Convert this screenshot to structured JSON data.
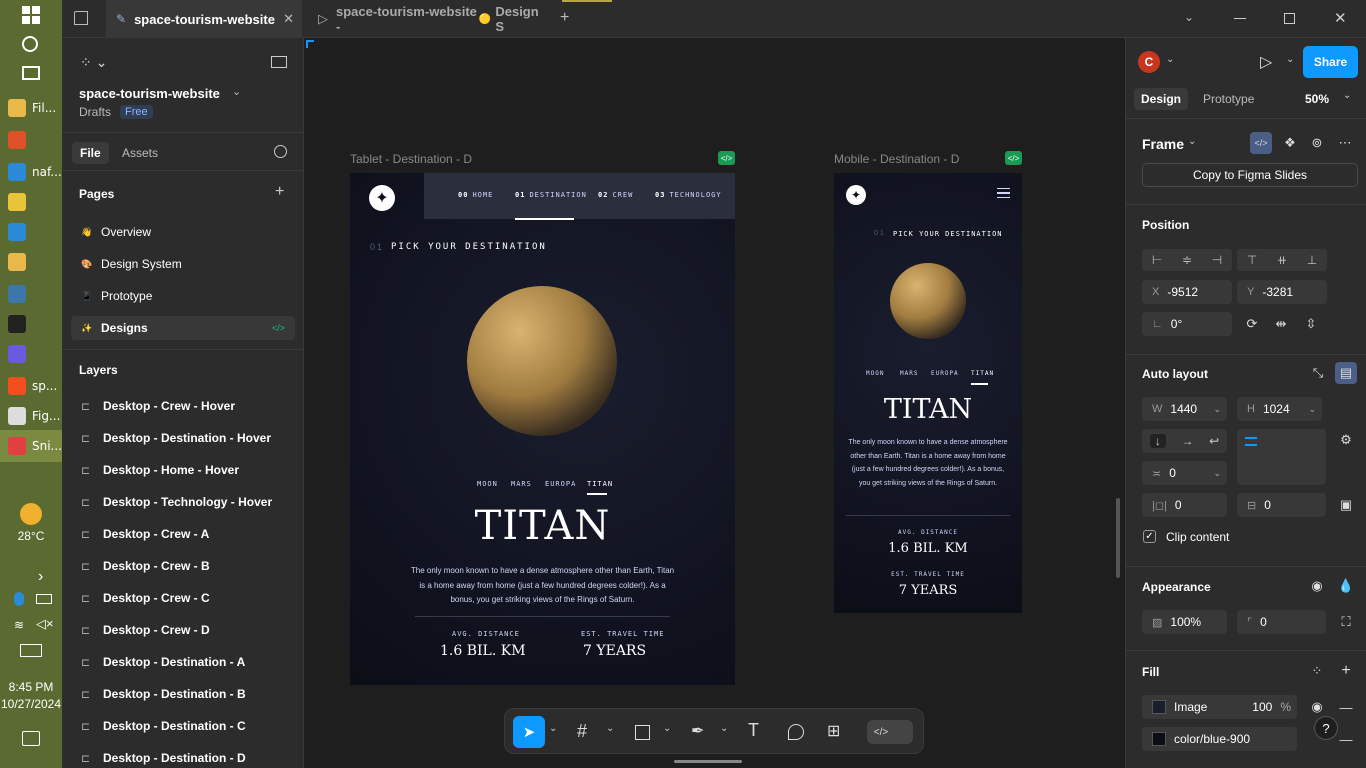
{
  "taskbar": {
    "items": [
      {
        "label": "Fil...",
        "icon": "folder-icon",
        "color": "#e8b84b"
      },
      {
        "label": "",
        "icon": "brave-icon",
        "color": "#e0502a"
      },
      {
        "label": "naf...",
        "icon": "edge-icon",
        "color": "#2b8ad8"
      },
      {
        "label": "",
        "icon": "chrome-icon",
        "color": "#e8c43a"
      },
      {
        "label": "",
        "icon": "vscode-icon",
        "color": "#2b8ad8"
      },
      {
        "label": "",
        "icon": "store-icon",
        "color": "#e8b84b"
      },
      {
        "label": "",
        "icon": "python-icon",
        "color": "#3b77a8"
      },
      {
        "label": "",
        "icon": "arc-icon",
        "color": "#222222"
      },
      {
        "label": "",
        "icon": "copilot-icon",
        "color": "#6a5ae0"
      },
      {
        "label": "sp...",
        "icon": "figma-icon",
        "color": "#f24e1e"
      },
      {
        "label": "Fig...",
        "icon": "figma-file-icon",
        "color": "#dddddd"
      },
      {
        "label": "Sni...",
        "icon": "snipping-icon",
        "color": "#e04040"
      }
    ],
    "weather": "28°C",
    "time": "8:45 PM",
    "date": "10/27/2024"
  },
  "tabs": [
    {
      "label": "space-tourism-website"
    },
    {
      "label": "space-tourism-website - ",
      "suffix": "Design S"
    }
  ],
  "left": {
    "project": "space-tourism-website",
    "drafts": "Drafts",
    "plan": "Free",
    "tab_file": "File",
    "tab_assets": "Assets",
    "pages_title": "Pages",
    "pages": [
      {
        "label": "Overview",
        "emoji": "👋"
      },
      {
        "label": "Design System",
        "emoji": "🎨"
      },
      {
        "label": "Prototype",
        "emoji": "📱"
      },
      {
        "label": "Designs",
        "emoji": "✨"
      }
    ],
    "layers_title": "Layers",
    "layers": [
      "Desktop - Crew - Hover",
      "Desktop - Destination - Hover",
      "Desktop - Home - Hover",
      "Desktop - Technology - Hover",
      "Desktop - Crew - A",
      "Desktop - Crew - B",
      "Desktop - Crew - C",
      "Desktop - Crew - D",
      "Desktop - Destination - A",
      "Desktop - Destination - B",
      "Desktop - Destination - C",
      "Desktop - Destination - D"
    ]
  },
  "canvas": {
    "tablet_label": "Tablet - Destination - D",
    "mobile_label": "Mobile - Destination - D",
    "nav": [
      {
        "num": "00",
        "label": "HOME"
      },
      {
        "num": "01",
        "label": "DESTINATION"
      },
      {
        "num": "02",
        "label": "CREW"
      },
      {
        "num": "03",
        "label": "TECHNOLOGY"
      }
    ],
    "heading_num": "01",
    "heading": "PICK YOUR DESTINATION",
    "destinations": [
      "MOON",
      "MARS",
      "EUROPA",
      "TITAN"
    ],
    "title": "TITAN",
    "desc_tablet": [
      "The only moon known to have a dense atmosphere other than Earth, Titan",
      "is a home away from home (just a few hundred degrees colder!). As a",
      "bonus, you get striking views of the Rings of Saturn."
    ],
    "desc_mobile": [
      "The only moon known to have a dense atmosphere",
      "other than Earth. Titan is a home away from home",
      "(just a few hundred degrees colder!). As a bonus,",
      "you get striking views of the Rings of Saturn."
    ],
    "stat1_label": "AVG. DISTANCE",
    "stat1_value": "1.6 BIL. KM",
    "stat2_label": "EST. TRAVEL TIME",
    "stat2_value": "7 YEARS"
  },
  "right": {
    "avatar": "C",
    "share": "Share",
    "tab_design": "Design",
    "tab_prototype": "Prototype",
    "zoom": "50%",
    "frame": "Frame",
    "copy_slides": "Copy to Figma Slides",
    "position": "Position",
    "x_label": "X",
    "x": "-9512",
    "y_label": "Y",
    "y": "-3281",
    "rotation": "0°",
    "auto_layout": "Auto layout",
    "w_label": "W",
    "w": "1440",
    "h_label": "H",
    "h": "1024",
    "gap": "0",
    "pad_h": "0",
    "pad_v": "0",
    "clip": "Clip content",
    "appearance": "Appearance",
    "opacity": "100%",
    "radius": "0",
    "fill": "Fill",
    "fill_type": "Image",
    "fill_opacity": "100",
    "fill_pct": "%",
    "fill_color": "color/blue-900",
    "help": "?"
  },
  "toolbar": {
    "tools": [
      "move-tool",
      "frame-tool",
      "shape-tool",
      "pen-tool",
      "text-tool",
      "comment-tool",
      "actions-tool",
      "dev-mode-toggle"
    ]
  },
  "colors": {
    "accent": "#0d99ff",
    "space_bg": "#0b0d17",
    "dev_green": "#1bc47d"
  }
}
